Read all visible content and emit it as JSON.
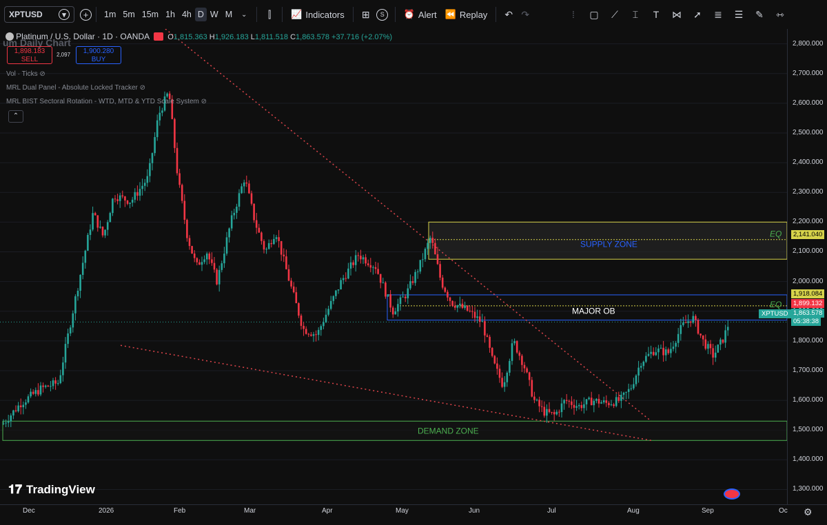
{
  "toolbar": {
    "symbol": "XPTUSD",
    "intervals": [
      "1m",
      "5m",
      "15m",
      "1h",
      "4h",
      "D",
      "W",
      "M"
    ],
    "active_interval": "D",
    "indicators_label": "Indicators",
    "alert_label": "Alert",
    "replay_label": "Replay",
    "templates_badge": "S"
  },
  "legend": {
    "title": "Platinum / U.S. Dollar · 1D · OANDA",
    "overlay_text": "um Daily Chart",
    "open_label": "O",
    "open": "1,815.363",
    "high_label": "H",
    "high": "1,926.183",
    "low_label": "L",
    "low": "1,811.518",
    "close_label": "C",
    "close": "1,863.578",
    "change": "+37.716 (+2.07%)"
  },
  "trade": {
    "sell_price": "1,898.183",
    "sell_label": "SELL",
    "spread": "2,097",
    "buy_price": "1,900.280",
    "buy_label": "BUY"
  },
  "indicators": [
    "Vol · Ticks",
    "MRL Dual Panel - Absolute Locked Tracker",
    "MRL BIST Sectoral Rotation - WTD, MTD & YTD Scale System"
  ],
  "price_scale": [
    "2,800.000",
    "2,700.000",
    "2,600.000",
    "2,500.000",
    "2,400.000",
    "2,300.000",
    "2,200.000",
    "2,100.000",
    "2,000.000",
    "1,900.000",
    "1,800.000",
    "1,700.000",
    "1,600.000",
    "1,500.000",
    "1,400.000",
    "1,300.000"
  ],
  "price_tags": {
    "supply_eq": "2,141.040",
    "ob_eq": "1,918.084",
    "ask": "1,899.132",
    "last": "1,863.578",
    "symbol_tag": "XPTUSD",
    "countdown": "05:38:38"
  },
  "time_scale": [
    "Dec",
    "2026",
    "Feb",
    "Mar",
    "Apr",
    "May",
    "Jun",
    "Jul",
    "Aug",
    "Sep",
    "Oc"
  ],
  "annotations": {
    "supply": "SUPPLY ZONE",
    "demand": "DEMAND ZONE",
    "major_ob": "MAJOR OB",
    "eq_supply": "EQ",
    "eq_ob": "EQ"
  },
  "branding": "TradingView",
  "colors": {
    "up": "#26a69a",
    "down": "#f23645",
    "supply_border": "#d6d24a",
    "ob_border": "#2962ff",
    "demand_border": "#4caf50",
    "trendline": "#e0454b",
    "eq_text": "#4caf50",
    "supply_text": "#2962ff"
  },
  "chart_data": {
    "type": "candlestick",
    "y_range": [
      1250,
      2850
    ],
    "x": [
      "Dec",
      "2026",
      "Feb",
      "Mar",
      "Apr",
      "May",
      "Jun",
      "Jul",
      "Aug",
      "Sep"
    ],
    "close": [
      1560,
      1700,
      2450,
      2260,
      1950,
      2080,
      1900,
      1600,
      1650,
      1864
    ],
    "zones": {
      "supply": [
        2075,
        2200
      ],
      "major_ob": [
        1870,
        1955
      ],
      "demand": [
        1465,
        1530
      ],
      "eq_supply": 2141.04,
      "eq_ob": 1918.084
    }
  }
}
